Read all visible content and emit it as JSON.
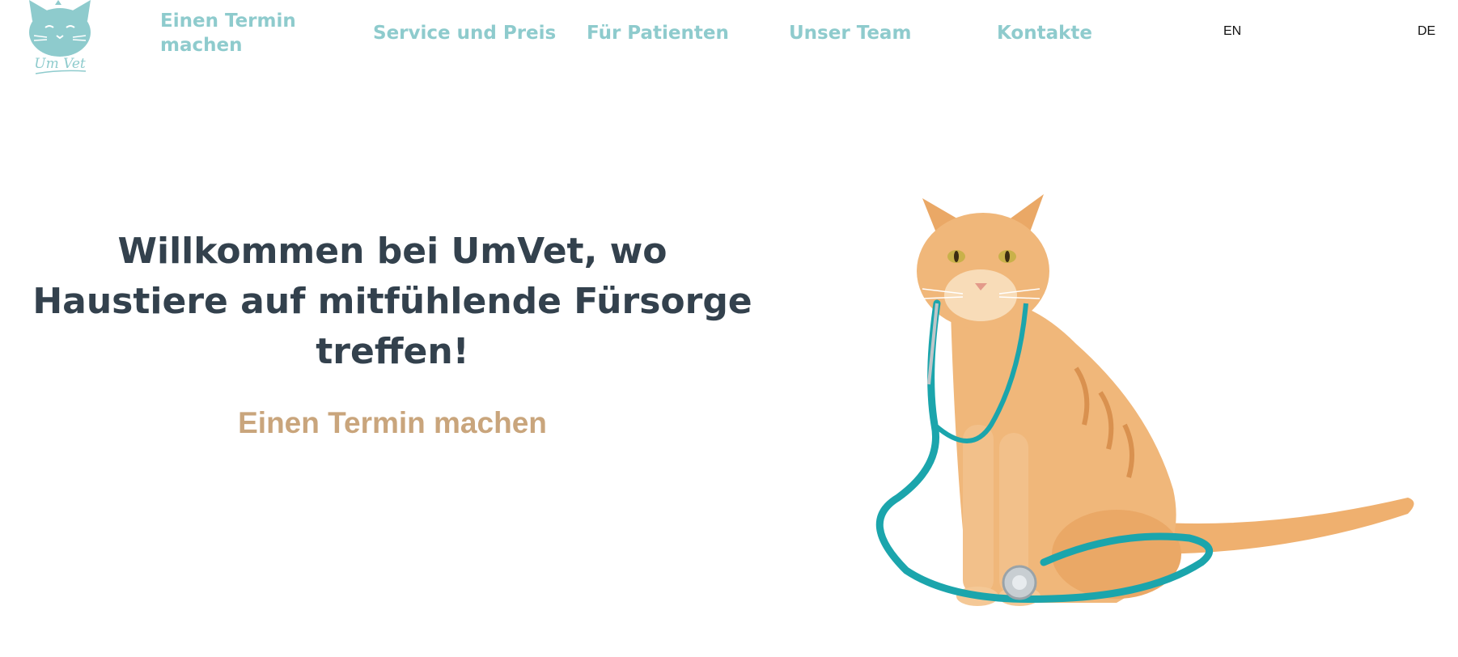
{
  "logo": {
    "text": "Um Vet",
    "color": "#8ecbcd"
  },
  "nav": {
    "appointment": "Einen Termin machen",
    "service": "Service und Preis",
    "patients": "Für Patienten",
    "team": "Unser Team",
    "contacts": "Kontakte"
  },
  "languages": {
    "en": "EN",
    "de": "DE"
  },
  "hero": {
    "title": "Willkommen bei UmVet, wo Haustiere auf mitfühlende Fürsorge treffen!",
    "cta": "Einen Termin machen",
    "image": "cat-with-stethoscope"
  },
  "colors": {
    "accent": "#8ecbcd",
    "heading": "#33414d",
    "cta": "#c9a57c",
    "stethoscope": "#1ba5ac",
    "cat": "#f0b77a"
  }
}
